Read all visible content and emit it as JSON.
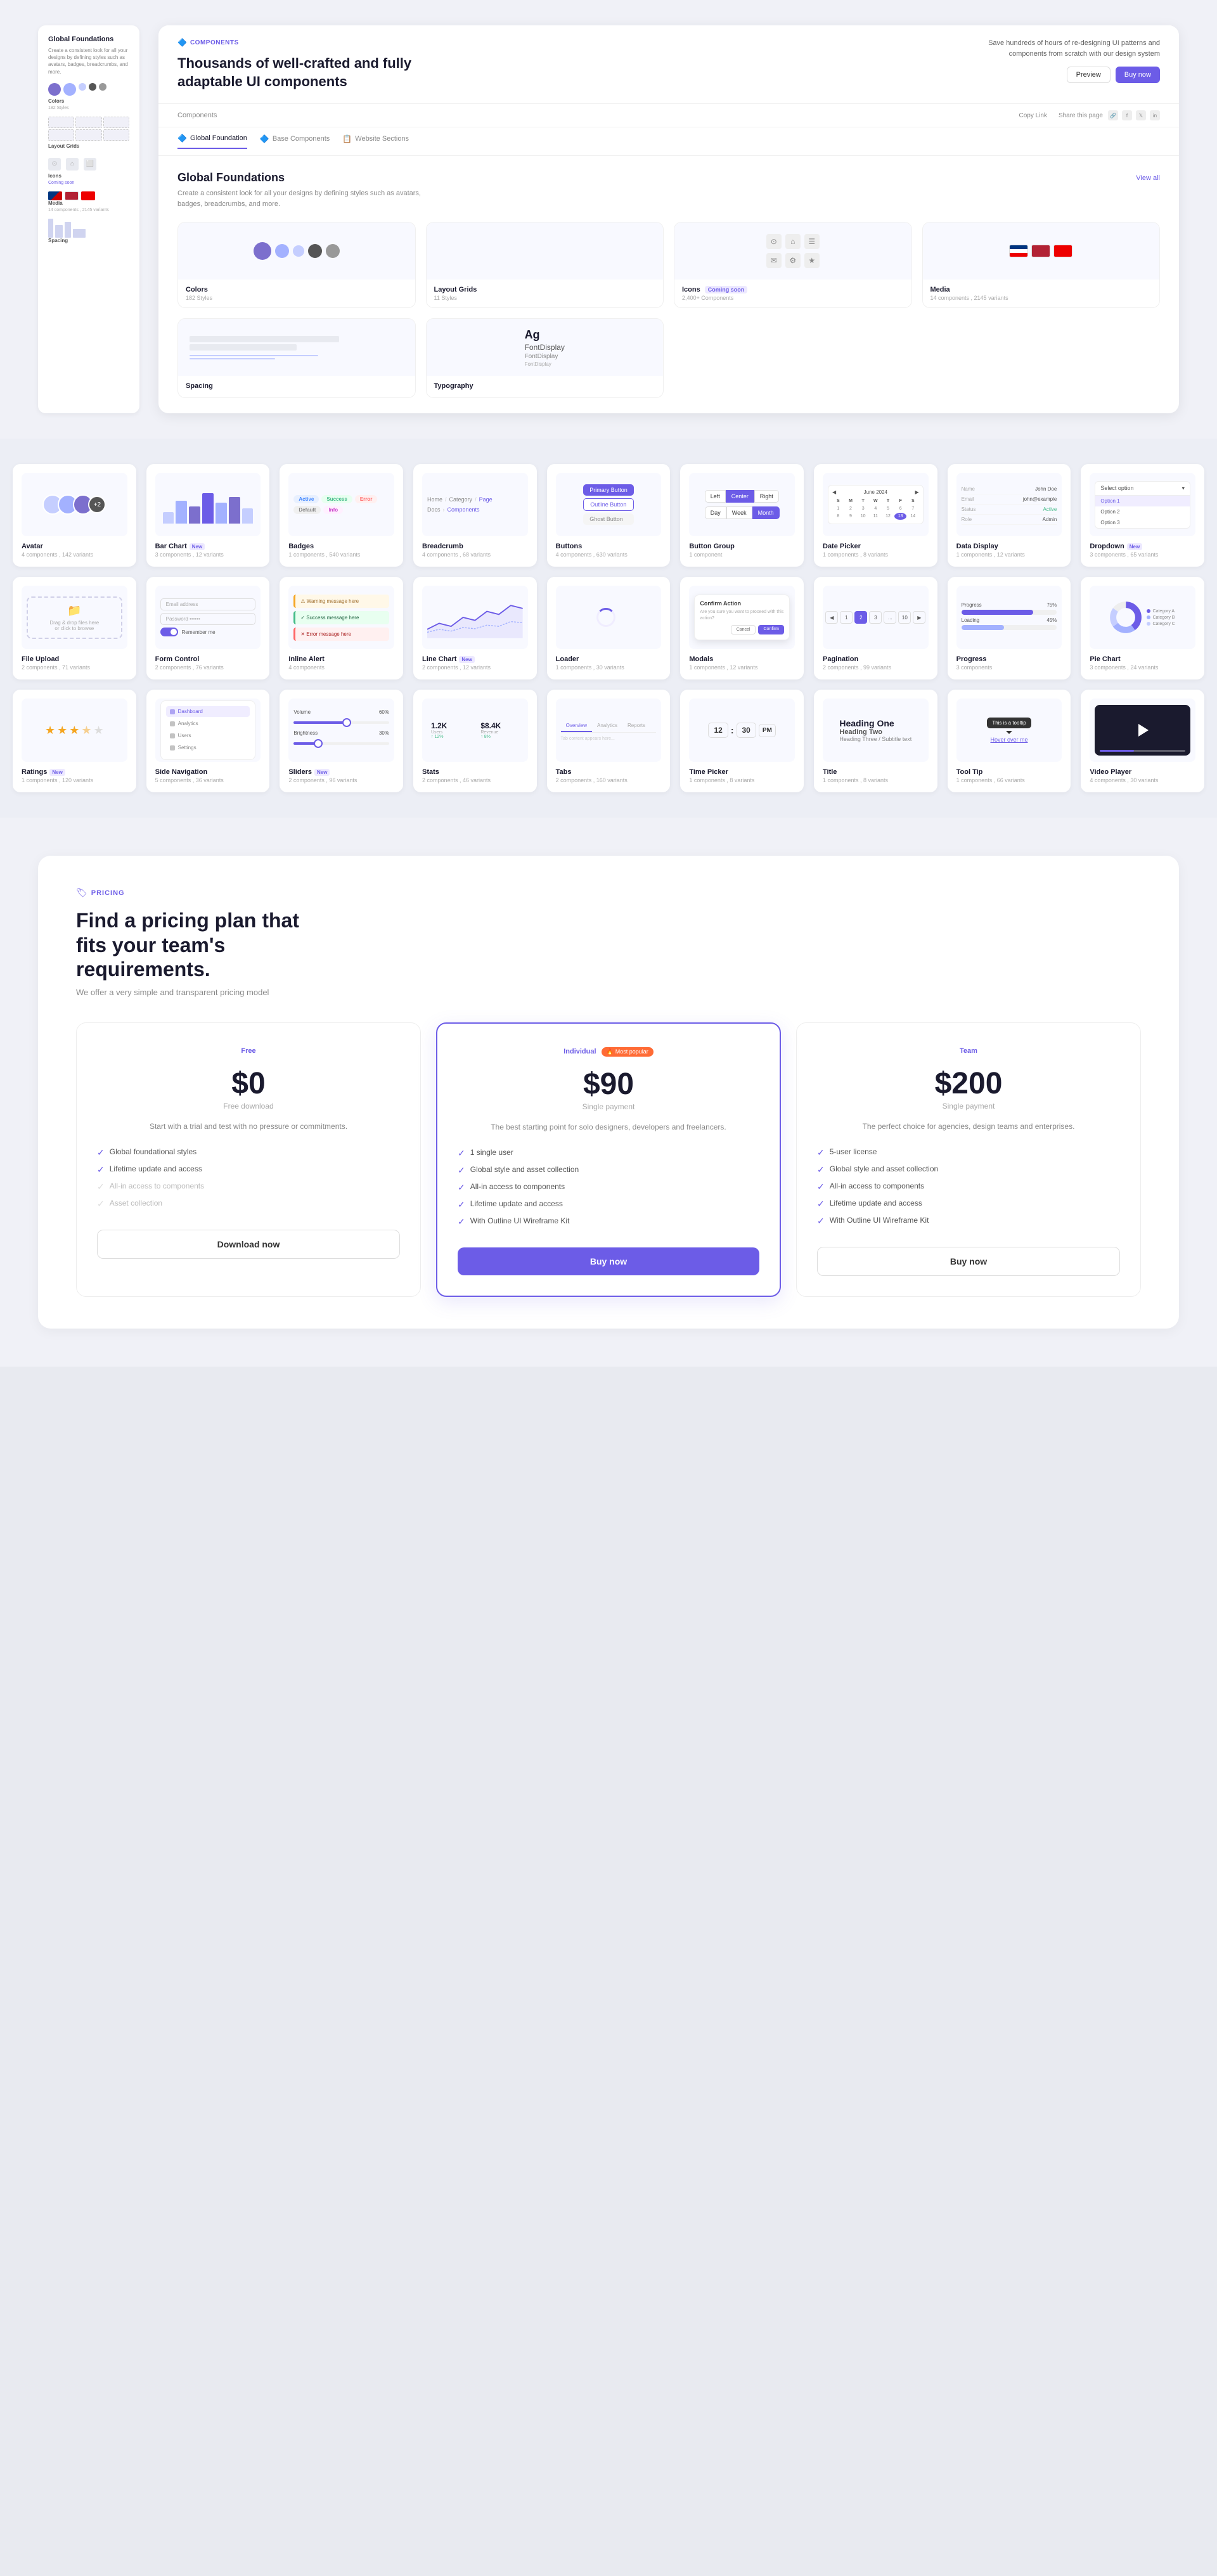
{
  "hero": {
    "tag": "COMPONENTS",
    "title": "Thousands of well-crafted and fully adaptable UI components",
    "description": "Save hundreds of hours of re-designing UI patterns and components from scratch with our design system",
    "buttons": {
      "preview": "Preview",
      "buynow": "Buy now"
    },
    "breadcrumb": "Components",
    "share": "Share this page",
    "copy_link": "Copy Link",
    "tabs": [
      {
        "label": "Global Foundation",
        "icon": "🔷"
      },
      {
        "label": "Base Components",
        "icon": "🔷"
      },
      {
        "label": "Website Sections",
        "icon": "📋"
      }
    ]
  },
  "foundations": {
    "title": "Global Foundations",
    "description": "Create a consistent look for all your designs by defining styles such as avatars, badges, breadcrumbs, and more.",
    "view_all": "View all",
    "items": [
      {
        "name": "Colors",
        "count": "182 Styles"
      },
      {
        "name": "Layout Grids",
        "count": "11 Styles"
      },
      {
        "name": "Icons",
        "count": "2,400+ Components",
        "tag": "Coming soon"
      },
      {
        "name": "Media",
        "count": "14 components , 2145 variants"
      },
      {
        "name": "Spacing",
        "count": ""
      },
      {
        "name": "Typography",
        "count": ""
      }
    ]
  },
  "sidebar": {
    "title": "Global Foundations",
    "description": "Create a consistent look for all your designs by defining styles such as avatars, badges, breadcrumbs, and more.",
    "items": [
      {
        "label": "Colors",
        "sub": "182 Styles"
      },
      {
        "label": "Layout Grids",
        "sub": ""
      },
      {
        "label": "Icons",
        "sub": "Coming soon"
      },
      {
        "label": "Media",
        "sub": "14 components , 2145 variants"
      },
      {
        "label": "Spacing",
        "sub": ""
      }
    ]
  },
  "components": {
    "items": [
      {
        "name": "Avatar",
        "count": "4 components , 142 variants"
      },
      {
        "name": "Bar Chart",
        "tag": "New",
        "count": "3 components , 12 variants"
      },
      {
        "name": "Badges",
        "count": "1 components , 540 variants"
      },
      {
        "name": "Breadcrumb",
        "count": "4 components , 68 variants"
      },
      {
        "name": "Buttons",
        "count": "4 components , 630 variants"
      },
      {
        "name": "Button Group",
        "count": "1 component"
      },
      {
        "name": "Date Picker",
        "count": "1 components , 8 variants"
      },
      {
        "name": "Data Display",
        "count": "1 components , 12 variants"
      },
      {
        "name": "Dropdown",
        "tag": "New",
        "count": "3 components , 65 variants"
      },
      {
        "name": "File Upload",
        "count": "2 components , 71 variants"
      },
      {
        "name": "Form Control",
        "count": "2 components , 76 variants"
      },
      {
        "name": "Inline Alert",
        "count": "4 components"
      },
      {
        "name": "Line Chart",
        "tag": "New",
        "count": "2 components , 12 variants"
      },
      {
        "name": "Loader",
        "count": "1 components , 30 variants"
      },
      {
        "name": "Modals",
        "count": "1 components , 12 variants"
      },
      {
        "name": "Pagination",
        "count": "2 components , 99 variants"
      },
      {
        "name": "Progress",
        "count": "3 components"
      },
      {
        "name": "Pie Chart",
        "count": "3 components , 24 variants"
      },
      {
        "name": "Ratings",
        "tag": "New",
        "count": "1 components , 120 variants"
      },
      {
        "name": "Side Navigation",
        "count": "5 components , 36 variants"
      },
      {
        "name": "Sliders",
        "tag": "New",
        "count": "2 components , 96 variants"
      },
      {
        "name": "Stats",
        "count": "2 components , 46 variants"
      },
      {
        "name": "Tabs",
        "count": "2 components , 160 variants"
      },
      {
        "name": "Time Picker",
        "count": "1 components , 8 variants"
      },
      {
        "name": "Title",
        "count": "1 components , 8 variants"
      },
      {
        "name": "Tool Tip",
        "count": "1 components , 66 variants"
      },
      {
        "name": "Video Player",
        "count": "4 components , 30 variants"
      }
    ]
  },
  "pricing": {
    "tag": "PRICING",
    "title": "Find a pricing plan that fits your team's requirements.",
    "description": "We offer a very simple and transparent pricing model",
    "plans": [
      {
        "name": "Free",
        "price": "$0",
        "period": "Free download",
        "tagline": "Start with a trial and test with no pressure or commitments.",
        "features": [
          {
            "text": "Global foundational styles",
            "enabled": true
          },
          {
            "text": "Lifetime update and access",
            "enabled": true
          },
          {
            "text": "All-in access to components",
            "enabled": false
          },
          {
            "text": "Asset collection",
            "enabled": false
          }
        ],
        "btn_label": "Download now",
        "featured": false
      },
      {
        "name": "Individual",
        "hot_badge": "Most popular",
        "price": "$90",
        "period": "Single payment",
        "tagline": "The best starting point for solo designers, developers and freelancers.",
        "features": [
          {
            "text": "1 single user",
            "enabled": true
          },
          {
            "text": "Global style and asset collection",
            "enabled": true
          },
          {
            "text": "All-in access to components",
            "enabled": true
          },
          {
            "text": "Lifetime update and access",
            "enabled": true
          },
          {
            "text": "With Outline UI Wireframe Kit",
            "enabled": true
          }
        ],
        "btn_label": "Buy now",
        "featured": true
      },
      {
        "name": "Team",
        "price": "$200",
        "period": "Single payment",
        "tagline": "The perfect choice for agencies, design teams and enterprises.",
        "features": [
          {
            "text": "5-user license",
            "enabled": true
          },
          {
            "text": "Global style and asset collection",
            "enabled": true
          },
          {
            "text": "All-in access to components",
            "enabled": true
          },
          {
            "text": "Lifetime update and access",
            "enabled": true
          },
          {
            "text": "With Outline UI Wireframe Kit",
            "enabled": true
          }
        ],
        "btn_label": "Buy now",
        "featured": false
      }
    ]
  }
}
